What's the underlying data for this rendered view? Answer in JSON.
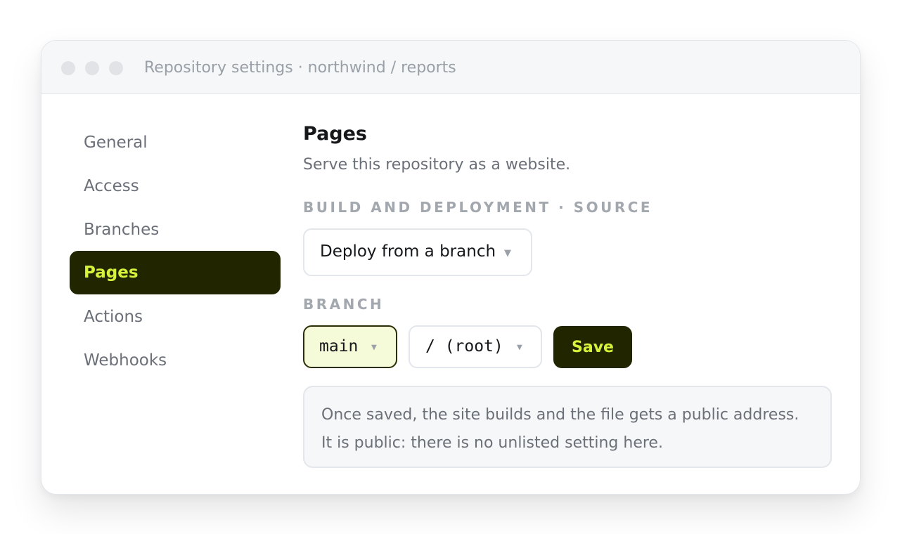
{
  "window": {
    "title": "Repository settings · northwind / reports"
  },
  "sidebar": {
    "items": [
      {
        "label": "General"
      },
      {
        "label": "Access"
      },
      {
        "label": "Branches"
      },
      {
        "label": "Pages",
        "active": true
      },
      {
        "label": "Actions"
      },
      {
        "label": "Webhooks"
      }
    ]
  },
  "main": {
    "title": "Pages",
    "subtitle": "Serve this repository as a website.",
    "source_label": "BUILD AND DEPLOYMENT · SOURCE",
    "source_value": "Deploy from a branch",
    "branch_label": "BRANCH",
    "branch_value": "main",
    "folder_value": "/ (root)",
    "save_label": "Save",
    "note_lines": [
      "Once saved, the site builds and the file gets a public address.",
      "It is public: there is no unlisted setting here."
    ]
  },
  "icons": {
    "dropdown": "caret-down-icon",
    "caret_glyph": "▼"
  },
  "colors": {
    "accent_dark": "#222600",
    "accent_lime": "#d6f23b",
    "branch_fill": "#f5fbd9"
  }
}
